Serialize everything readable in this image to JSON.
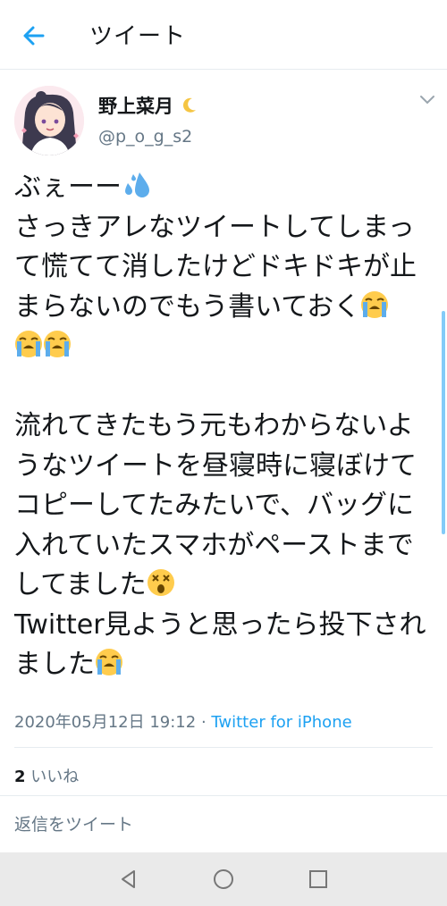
{
  "header": {
    "title": "ツイート"
  },
  "user": {
    "display_name": "野上菜月",
    "username": "@p_o_g_s2"
  },
  "tweet": {
    "l1": "ぶぇーー",
    "l2": "さっきアレなツイートしてしまっ",
    "l3": "て慌てて消したけどドキドキが止",
    "l4": "まらないのでもう書いておく",
    "l6": "流れてきたもう元もわからないよ",
    "l7": "うなツイートを昼寝時に寝ぼけて",
    "l8": "コピーしてたみたいで、バッグに",
    "l9": "入れていたスマホがペーストまで",
    "l10": "してました",
    "l11": "Twitter見ようと思ったら投下され",
    "l12": "ました"
  },
  "meta": {
    "timestamp": "2020年05月12日 19:12",
    "separator": " · ",
    "source": "Twitter for iPhone"
  },
  "stats": {
    "likes_count": "2",
    "likes_label": "いいね"
  },
  "reply": {
    "placeholder": "返信をツイート"
  },
  "icons": [
    "back-arrow-icon",
    "crescent-moon-icon",
    "chevron-down-icon",
    "sweat-droplets-icon",
    "loudly-crying-face-icon",
    "dizzy-face-icon",
    "nav-back-icon",
    "nav-home-icon",
    "nav-recents-icon"
  ],
  "colors": {
    "accent": "#1da1f2",
    "text": "#14171a",
    "secondary": "#657786",
    "border": "#e6ecf0",
    "navbar": "#eaeaea"
  }
}
